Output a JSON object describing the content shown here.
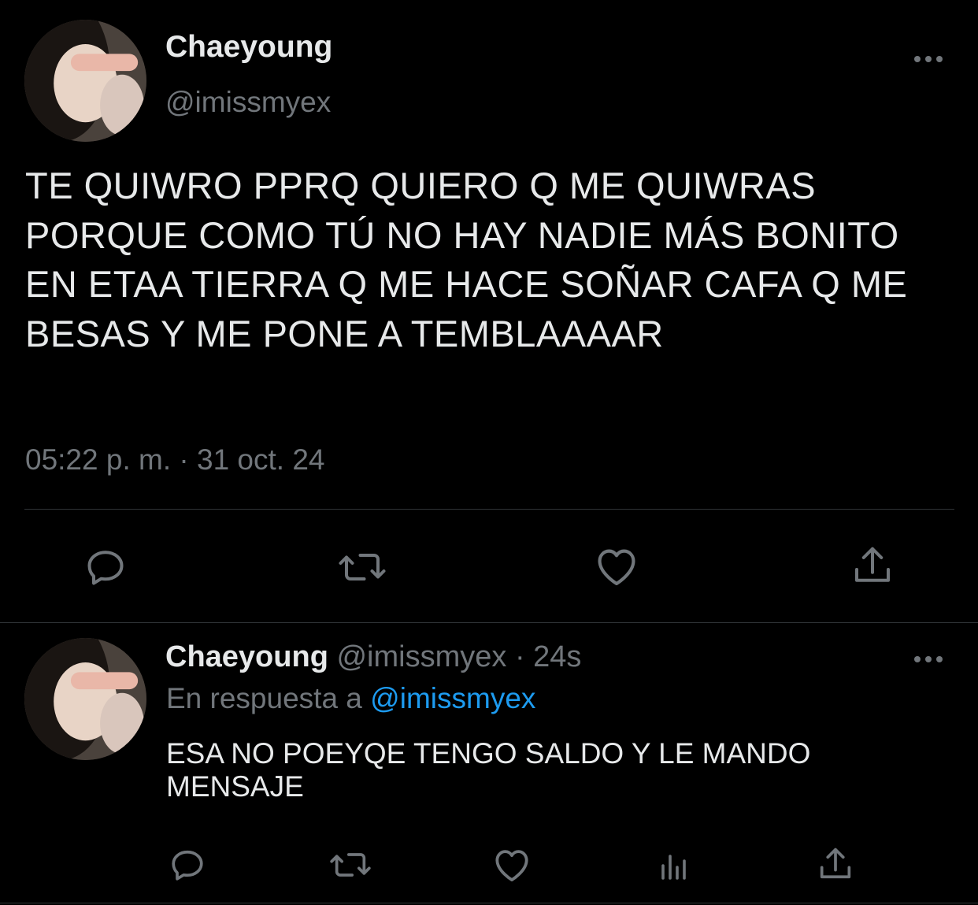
{
  "main_tweet": {
    "author": {
      "name": "Chaeyoung",
      "handle": "@imissmyex"
    },
    "text": "TE QUIWRO PPRQ QUIERO Q ME QUIWRAS PORQUE COMO TÚ NO HAY NADIE MÁS BONITO EN ETAA TIERRA Q ME HACE SOÑAR CAFA Q ME BESAS Y ME PONE A TEMBLAAAAR",
    "timestamp": "05:22 p. m. · 31 oct. 24",
    "actions": [
      "reply-icon",
      "retweet-icon",
      "like-icon",
      "share-icon"
    ]
  },
  "reply_tweet": {
    "author": {
      "name": "Chaeyoung",
      "handle": "@imissmyex"
    },
    "meta_sep": "·",
    "time": "24s",
    "in_reply_prefix": "En respuesta a",
    "in_reply_handle": "@imissmyex",
    "text": "ESA NO POEYQE TENGO SALDO Y LE MANDO MENSAJE",
    "actions": [
      "reply-icon",
      "retweet-icon",
      "like-icon",
      "analytics-icon",
      "share-icon"
    ]
  },
  "colors": {
    "background": "#000000",
    "primary_text": "#e7e9ea",
    "secondary_text": "#71767b",
    "link": "#1d9bf0",
    "divider": "#2f3336"
  }
}
